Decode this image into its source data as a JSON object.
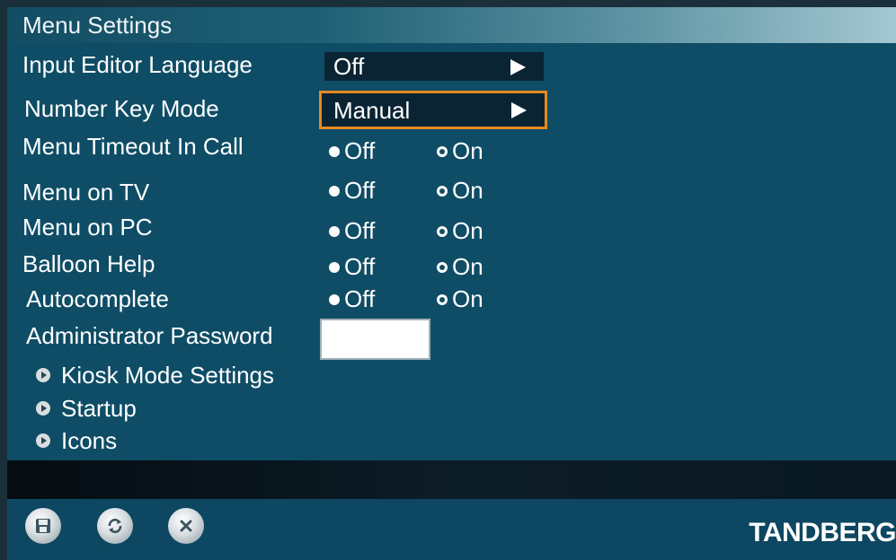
{
  "header": {
    "title": "Menu Settings"
  },
  "settings": {
    "input_editor_language": {
      "label": "Input Editor Language",
      "value": "Off"
    },
    "number_key_mode": {
      "label": "Number Key Mode",
      "value": "Manual"
    },
    "radio_options": {
      "off": "Off",
      "on": "On"
    },
    "menu_timeout_in_call": {
      "label": "Menu Timeout In Call",
      "selected": "On"
    },
    "menu_on_tv": {
      "label": "Menu on TV",
      "selected": "On"
    },
    "menu_on_pc": {
      "label": "Menu on PC",
      "selected": "On"
    },
    "balloon_help": {
      "label": "Balloon Help",
      "selected": "On"
    },
    "autocomplete": {
      "label": "Autocomplete",
      "selected": "On"
    },
    "administrator_password": {
      "label": "Administrator Password",
      "value": ""
    }
  },
  "submenus": [
    {
      "label": "Kiosk Mode Settings"
    },
    {
      "label": "Startup"
    },
    {
      "label": "Icons"
    }
  ],
  "footer": {
    "buttons": [
      "save-icon",
      "refresh-icon",
      "close-icon"
    ],
    "brand": "TANDBERG"
  },
  "colors": {
    "panel": "#0f4d66",
    "focus_border": "#e58a1f",
    "dropdown_bg": "#0a2433"
  }
}
